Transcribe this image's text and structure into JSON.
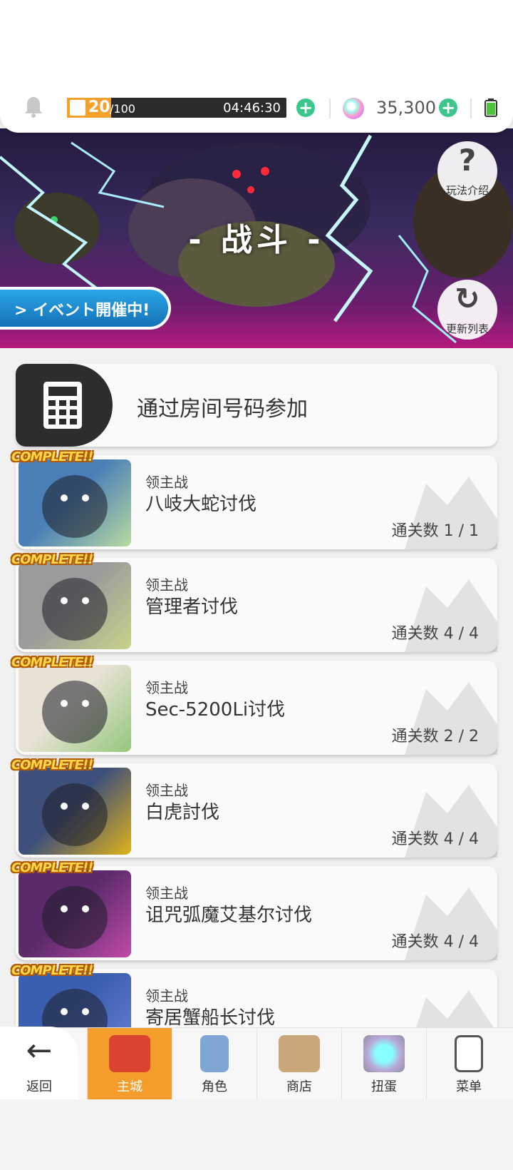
{
  "status": {
    "stamina_current": "20",
    "stamina_max": "/100",
    "stamina_fraction": 0.2,
    "timer": "04:46:30",
    "gems": "35,300"
  },
  "banner": {
    "title": "- 战斗 -",
    "event_label": "> イベント開催中!",
    "help_label": "玩法介绍",
    "refresh_label": "更新列表"
  },
  "join": {
    "label": "通过房间号码参加"
  },
  "complete_label": "COMPLETE!!",
  "bosses": [
    {
      "type": "领主战",
      "name": "八岐大蛇讨伐",
      "clears": "通关数 1 / 1",
      "color1": "#4a7fb8",
      "color2": "#b9dba0"
    },
    {
      "type": "领主战",
      "name": "管理者讨伐",
      "clears": "通关数 4 / 4",
      "color1": "#9b9b9b",
      "color2": "#c9d28a"
    },
    {
      "type": "领主战",
      "name": "Sec-5200Li讨伐",
      "clears": "通关数 2 / 2",
      "color1": "#e8e2d4",
      "color2": "#93c77b"
    },
    {
      "type": "领主战",
      "name": "白虎討伐",
      "clears": "通关数 4 / 4",
      "color1": "#3d4f7a",
      "color2": "#e0b31a"
    },
    {
      "type": "领主战",
      "name": "诅咒弧魔艾基尔讨伐",
      "clears": "通关数 4 / 4",
      "color1": "#5a2a6a",
      "color2": "#c04aa8"
    },
    {
      "type": "领主战",
      "name": "寄居蟹船长讨伐",
      "clears": "",
      "color1": "#3a5fb0",
      "color2": "#6b7fd6"
    }
  ],
  "nav": {
    "back": "返回",
    "items": [
      "主城",
      "角色",
      "商店",
      "扭蛋",
      "菜单"
    ],
    "active_index": 0
  }
}
